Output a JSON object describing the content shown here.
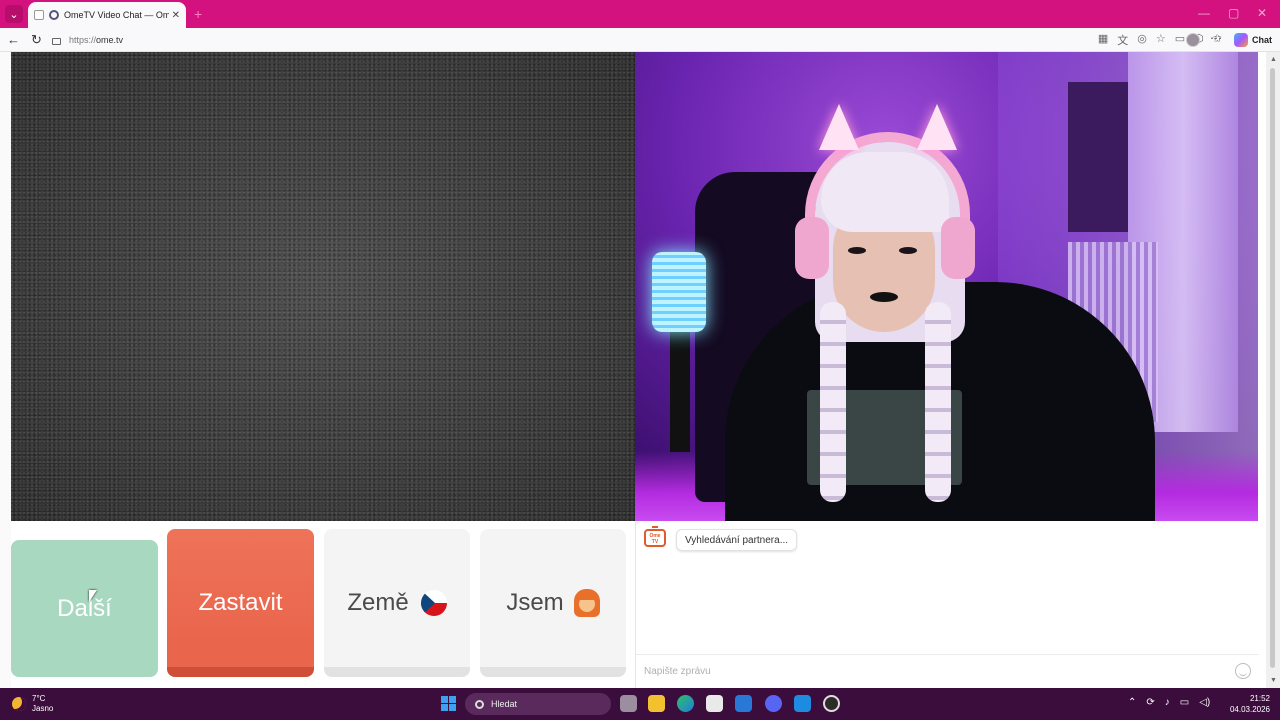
{
  "browser": {
    "tab_title": "OmeTV Video Chat — Omeg",
    "tab_close": "✕",
    "new_tab": "+",
    "url_protocol": "https://",
    "url_domain": "ome.tv",
    "copilot_label": "Chat"
  },
  "controls": {
    "next_label": "Další",
    "stop_label": "Zastavit",
    "country_label": "Země",
    "country_flag": "cz-flag-icon",
    "gender_label": "Jsem",
    "gender_icon": "woman-emoji-icon"
  },
  "chat": {
    "status_message": "Vyhledávání partnera...",
    "logo_text": "Ome TV",
    "input_placeholder": "Napište zprávu"
  },
  "taskbar": {
    "temperature": "7°C",
    "weather_condition": "Jasno",
    "search_label": "Hledat",
    "time": "21:52",
    "date": "04.03.2026"
  },
  "colors": {
    "browser_accent": "#d4127f",
    "next_button": "#a8d8bf",
    "stop_button": "#ee7358",
    "neutral_button": "#f4f4f4"
  }
}
